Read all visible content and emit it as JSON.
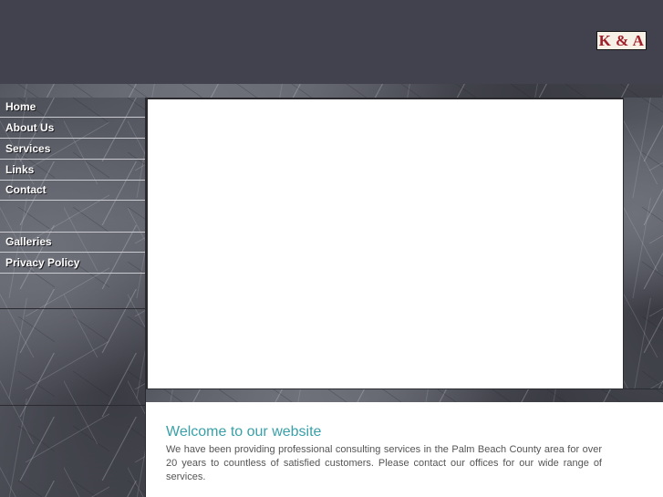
{
  "header": {
    "logo_text": "K & A"
  },
  "nav": {
    "items": [
      {
        "label": "Home"
      },
      {
        "label": "About Us"
      },
      {
        "label": "Services"
      },
      {
        "label": "Links"
      },
      {
        "label": "Contact"
      },
      {
        "label": "Galleries"
      },
      {
        "label": "Privacy Policy"
      }
    ]
  },
  "content": {
    "title": "Welcome to our website",
    "body": "We have been providing professional consulting services in the Palm Beach County area for over 20 years to countless of satisfied customers. Please contact our offices for our wide range of services."
  },
  "colors": {
    "header_bg": "#42424f",
    "title_color": "#3aa0a8",
    "logo_text": "#a0202a"
  }
}
